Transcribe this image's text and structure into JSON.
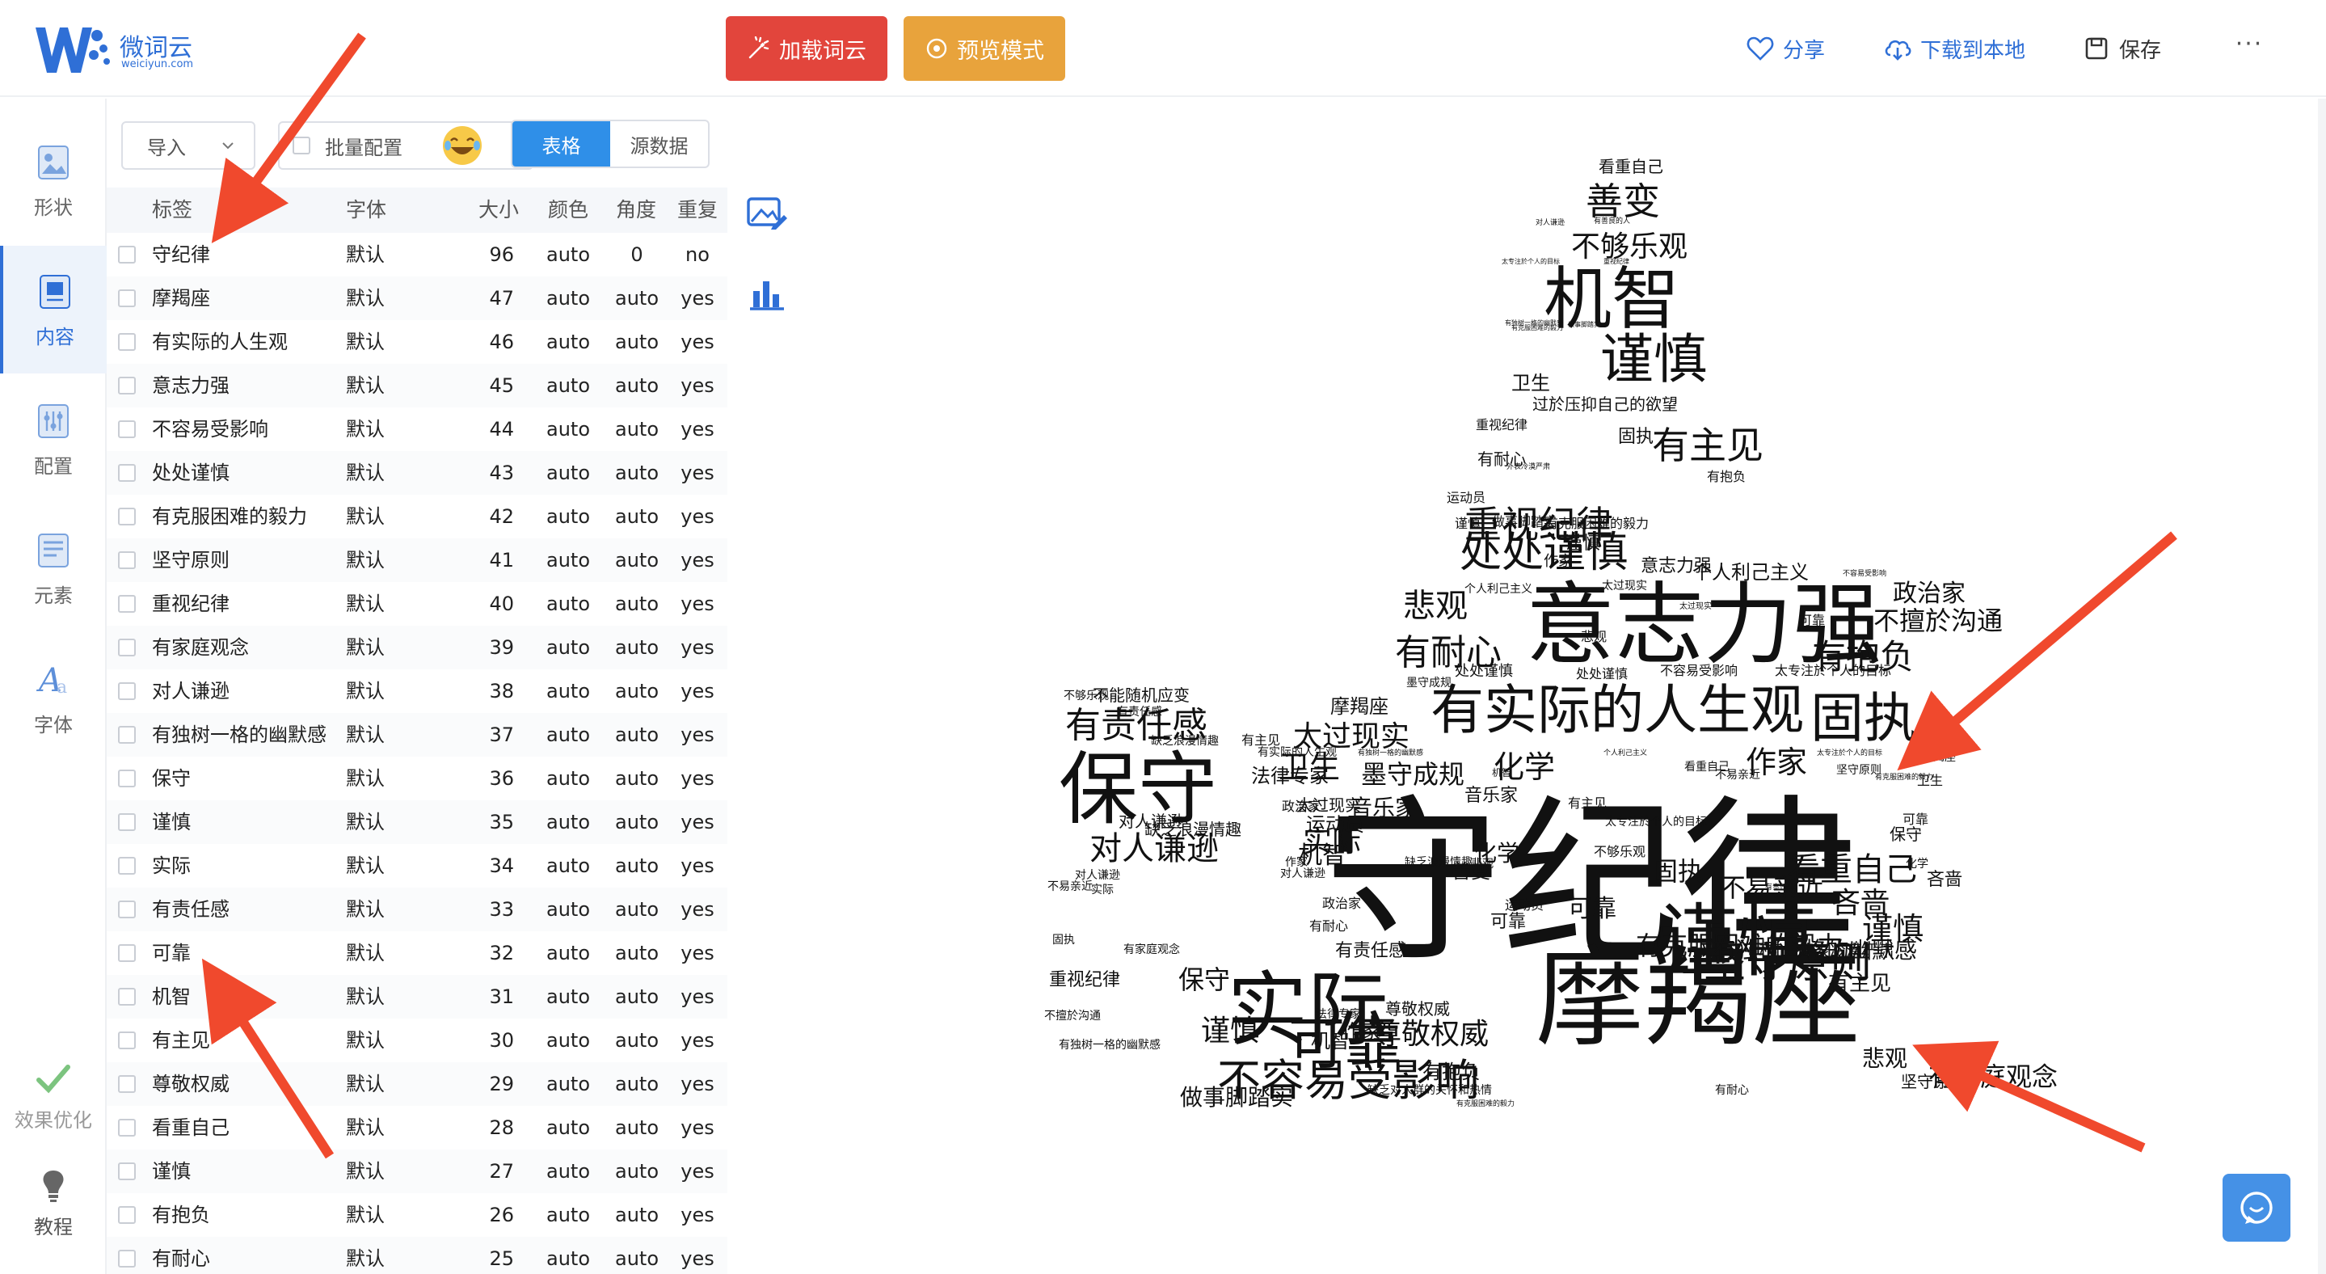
{
  "app": {
    "name": "微词云",
    "domain": "weiciyun.com"
  },
  "header": {
    "load_button": "加载词云",
    "preview_button": "预览模式",
    "share": "分享",
    "download": "下载到本地",
    "save": "保存",
    "more": "···",
    "colors": {
      "load": "#e2453c",
      "preview": "#e8a33c",
      "accent": "#2f6fd6"
    }
  },
  "sidebar": {
    "items": [
      {
        "label": "形状",
        "icon": "shape-icon"
      },
      {
        "label": "内容",
        "icon": "content-icon"
      },
      {
        "label": "配置",
        "icon": "config-icon"
      },
      {
        "label": "元素",
        "icon": "element-icon"
      },
      {
        "label": "字体",
        "icon": "font-icon"
      }
    ],
    "optimize": "效果优化",
    "tutorial": "教程"
  },
  "panel": {
    "import_label": "导入",
    "batch_label": "批量配置",
    "tab_table": "表格",
    "tab_source": "源数据",
    "columns": [
      "标签",
      "字体",
      "大小",
      "颜色",
      "角度",
      "重复"
    ],
    "rows": [
      [
        "守纪律",
        "默认",
        "96",
        "auto",
        "0",
        "no"
      ],
      [
        "摩羯座",
        "默认",
        "47",
        "auto",
        "auto",
        "yes"
      ],
      [
        "有实际的人生观",
        "默认",
        "46",
        "auto",
        "auto",
        "yes"
      ],
      [
        "意志力强",
        "默认",
        "45",
        "auto",
        "auto",
        "yes"
      ],
      [
        "不容易受影响",
        "默认",
        "44",
        "auto",
        "auto",
        "yes"
      ],
      [
        "处处谨慎",
        "默认",
        "43",
        "auto",
        "auto",
        "yes"
      ],
      [
        "有克服困难的毅力",
        "默认",
        "42",
        "auto",
        "auto",
        "yes"
      ],
      [
        "坚守原则",
        "默认",
        "41",
        "auto",
        "auto",
        "yes"
      ],
      [
        "重视纪律",
        "默认",
        "40",
        "auto",
        "auto",
        "yes"
      ],
      [
        "有家庭观念",
        "默认",
        "39",
        "auto",
        "auto",
        "yes"
      ],
      [
        "对人谦逊",
        "默认",
        "38",
        "auto",
        "auto",
        "yes"
      ],
      [
        "有独树一格的幽默感",
        "默认",
        "37",
        "auto",
        "auto",
        "yes"
      ],
      [
        "保守",
        "默认",
        "36",
        "auto",
        "auto",
        "yes"
      ],
      [
        "谨慎",
        "默认",
        "35",
        "auto",
        "auto",
        "yes"
      ],
      [
        "实际",
        "默认",
        "34",
        "auto",
        "auto",
        "yes"
      ],
      [
        "有责任感",
        "默认",
        "33",
        "auto",
        "auto",
        "yes"
      ],
      [
        "可靠",
        "默认",
        "32",
        "auto",
        "auto",
        "yes"
      ],
      [
        "机智",
        "默认",
        "31",
        "auto",
        "auto",
        "yes"
      ],
      [
        "有主见",
        "默认",
        "30",
        "auto",
        "auto",
        "yes"
      ],
      [
        "尊敬权威",
        "默认",
        "29",
        "auto",
        "auto",
        "yes"
      ],
      [
        "看重自己",
        "默认",
        "28",
        "auto",
        "auto",
        "yes"
      ],
      [
        "谨慎",
        "默认",
        "27",
        "auto",
        "auto",
        "yes"
      ],
      [
        "有抱负",
        "默认",
        "26",
        "auto",
        "auto",
        "yes"
      ],
      [
        "有耐心",
        "默认",
        "25",
        "auto",
        "auto",
        "yes"
      ]
    ]
  },
  "cloud_words": [
    [
      "看重自己",
      20
    ],
    [
      "善变",
      46
    ],
    [
      "对人谦逊",
      9
    ],
    [
      "有善良的人",
      9
    ],
    [
      "不够乐观",
      36
    ],
    [
      "太专注於个人的目标",
      8
    ],
    [
      "重视纪律",
      8
    ],
    [
      "机智",
      84
    ],
    [
      "有独树一格的幽默感",
      8
    ],
    [
      "做事脚踏实",
      8
    ],
    [
      "有克服困难的毅力",
      8
    ],
    [
      "谨慎",
      66
    ],
    [
      "卫生",
      24
    ],
    [
      "过於压抑自己的欲望",
      20
    ],
    [
      "重视纪律",
      16
    ],
    [
      "有主见",
      46
    ],
    [
      "固执",
      22
    ],
    [
      "有耐心",
      20
    ],
    [
      "外表冷漠严肃",
      9
    ],
    [
      "有抱负",
      16
    ],
    [
      "运动员",
      16
    ],
    [
      "重视纪律",
      46
    ],
    [
      "谨慎",
      16
    ],
    [
      "做事脚踏实",
      16
    ],
    [
      "有克服困难的毅力",
      16
    ],
    [
      "处处谨慎",
      52
    ],
    [
      "谨慎",
      22
    ],
    [
      "作家",
      18
    ],
    [
      "意志力强",
      22
    ],
    [
      "个人利己主义",
      24
    ],
    [
      "不容易受影响",
      9
    ],
    [
      "个人利己主义",
      14
    ],
    [
      "太过现实",
      14
    ],
    [
      "政治家",
      30
    ],
    [
      "悲观",
      40
    ],
    [
      "意志力强",
      110
    ],
    [
      "太过现实",
      10
    ],
    [
      "可靠",
      16
    ],
    [
      "不擅於沟通",
      32
    ],
    [
      "悲观",
      16
    ],
    [
      "有耐心",
      44
    ],
    [
      "有抱负",
      42
    ],
    [
      "处处谨慎",
      18
    ],
    [
      "处处谨慎",
      16
    ],
    [
      "不容易受影响",
      16
    ],
    [
      "太专注於个人的目标",
      16
    ],
    [
      "墨守成规",
      14
    ],
    [
      "有实际的人生观",
      66
    ],
    [
      "固执",
      66
    ],
    [
      "不够乐观",
      14
    ],
    [
      "不能随机应变",
      20
    ],
    [
      "摩羯座",
      24
    ],
    [
      "有责任感",
      44
    ],
    [
      "有责任感",
      14
    ],
    [
      "太过现实",
      36
    ],
    [
      "有主见",
      16
    ],
    [
      "缺乏浪漫情趣",
      14
    ],
    [
      "有实际的人生观",
      14
    ],
    [
      "有独树一格的幽默感",
      9
    ],
    [
      "个人利己主义",
      9
    ],
    [
      "太专注於个人的目标",
      9
    ],
    [
      "保守",
      98
    ],
    [
      "法律专家",
      24
    ],
    [
      "墨守成规",
      32
    ],
    [
      "看重自己",
      14
    ],
    [
      "坚守原则",
      14
    ],
    [
      "摩羯座",
      14
    ],
    [
      "卫生",
      38
    ],
    [
      "化学",
      38
    ],
    [
      "作家",
      38
    ],
    [
      "卫生",
      16
    ],
    [
      "音乐家",
      28
    ],
    [
      "守纪律",
      220
    ],
    [
      "机智",
      12
    ],
    [
      "不易亲近",
      14
    ],
    [
      "有克服困难的毅力",
      9
    ],
    [
      "政治家",
      16
    ],
    [
      "对人谦逊",
      20
    ],
    [
      "缺乏浪漫情趣",
      20
    ],
    [
      "太过现实",
      20
    ],
    [
      "对人谦逊",
      40
    ],
    [
      "化学",
      28
    ],
    [
      "有主见",
      16
    ],
    [
      "运动员",
      24
    ],
    [
      "不够乐观",
      16
    ],
    [
      "音乐家",
      22
    ],
    [
      "可靠",
      16
    ],
    [
      "保守",
      20
    ],
    [
      "实际",
      36
    ],
    [
      "机智",
      30
    ],
    [
      "缺乏浪漫情趣",
      14
    ],
    [
      "悲观",
      14
    ],
    [
      "太专注於个人的目标",
      14
    ],
    [
      "作家",
      14
    ],
    [
      "固执",
      32
    ],
    [
      "看重自己",
      40
    ],
    [
      "化学",
      14
    ],
    [
      "对人谦逊",
      14
    ],
    [
      "不易亲近",
      14
    ],
    [
      "实际",
      14
    ],
    [
      "善变",
      24
    ],
    [
      "可靠",
      30
    ],
    [
      "不易亲近",
      32
    ],
    [
      "有责任感",
      9
    ],
    [
      "谨慎",
      98
    ],
    [
      "吝啬",
      36
    ],
    [
      "吝啬",
      22
    ],
    [
      "对人谦逊",
      14
    ],
    [
      "有家庭观念",
      14
    ],
    [
      "有耐心",
      16
    ],
    [
      "政治家",
      16
    ],
    [
      "运动员",
      16
    ],
    [
      "可靠",
      22
    ],
    [
      "有克服困难的毅力",
      32
    ],
    [
      "谨慎",
      38
    ],
    [
      "坚守原则",
      52
    ],
    [
      "固执",
      14
    ],
    [
      "摩羯座",
      134
    ],
    [
      "有独树一格的幽默感",
      28
    ],
    [
      "外表冷漠严肃",
      20
    ],
    [
      "重视纪律",
      22
    ],
    [
      "有责任感",
      22
    ],
    [
      "实际",
      100
    ],
    [
      "保守",
      32
    ],
    [
      "谨慎",
      36
    ],
    [
      "可靠",
      70
    ],
    [
      "法律专家",
      14
    ],
    [
      "不擅於沟通",
      14
    ],
    [
      "有独树一格的幽默感",
      14
    ],
    [
      "有主见",
      26
    ],
    [
      "尊敬权威",
      20
    ],
    [
      "尊敬权威",
      36
    ],
    [
      "作家",
      24
    ],
    [
      "有抱负",
      24
    ],
    [
      "机智",
      24
    ],
    [
      "有家庭观念",
      32
    ],
    [
      "做事脚踏实",
      28
    ],
    [
      "不容易受影响",
      54
    ],
    [
      "坚守原则",
      20
    ],
    [
      "悲观",
      28
    ],
    [
      "缺乏对人群的关怀和热情",
      14
    ],
    [
      "有克服困难的毅力",
      9
    ],
    [
      "有耐心",
      14
    ]
  ]
}
